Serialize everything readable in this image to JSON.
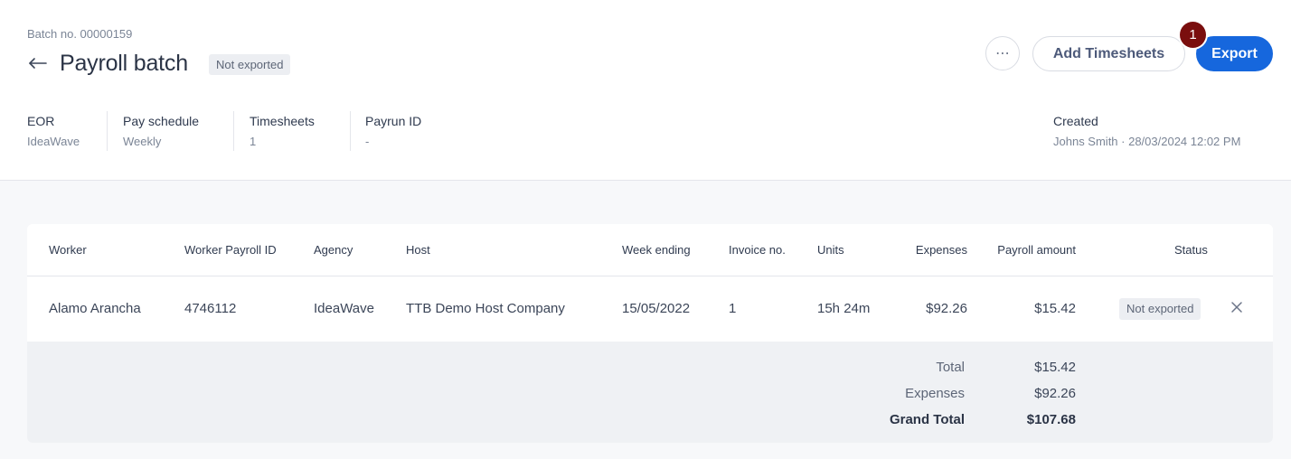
{
  "header": {
    "batch_no": "Batch no. 00000159",
    "title": "Payroll batch",
    "status_badge": "Not exported",
    "more_label": "⋯",
    "add_timesheets_label": "Add Timesheets",
    "export_label": "Export",
    "step_number": "1"
  },
  "meta": {
    "eor": {
      "label": "EOR",
      "value": "IdeaWave"
    },
    "pay_schedule": {
      "label": "Pay schedule",
      "value": "Weekly"
    },
    "timesheets": {
      "label": "Timesheets",
      "value": "1"
    },
    "payrun_id": {
      "label": "Payrun ID",
      "value": "-"
    },
    "created": {
      "label": "Created",
      "value": "Johns Smith · 28/03/2024 12:02 PM"
    }
  },
  "table": {
    "columns": {
      "worker": "Worker",
      "worker_payroll_id": "Worker Payroll ID",
      "agency": "Agency",
      "host": "Host",
      "week_ending": "Week ending",
      "invoice_no": "Invoice no.",
      "units": "Units",
      "expenses": "Expenses",
      "payroll_amount": "Payroll amount",
      "status": "Status"
    },
    "rows": [
      {
        "worker": "Alamo Arancha",
        "worker_payroll_id": "4746112",
        "agency": "IdeaWave",
        "host": "TTB Demo Host Company",
        "week_ending": "15/05/2022",
        "invoice_no": "1",
        "units": "15h 24m",
        "expenses": "$92.26",
        "payroll_amount": "$15.42",
        "status": "Not exported"
      }
    ]
  },
  "totals": {
    "total_label": "Total",
    "total_value": "$15.42",
    "expenses_label": "Expenses",
    "expenses_value": "$92.26",
    "grand_total_label": "Grand Total",
    "grand_total_value": "$107.68"
  },
  "colors": {
    "accent": "#1667dd",
    "step_badge": "#7a0e0e"
  },
  "icons": {
    "back": "arrow-left-icon",
    "more": "more-horizontal-icon",
    "remove": "close-icon"
  }
}
